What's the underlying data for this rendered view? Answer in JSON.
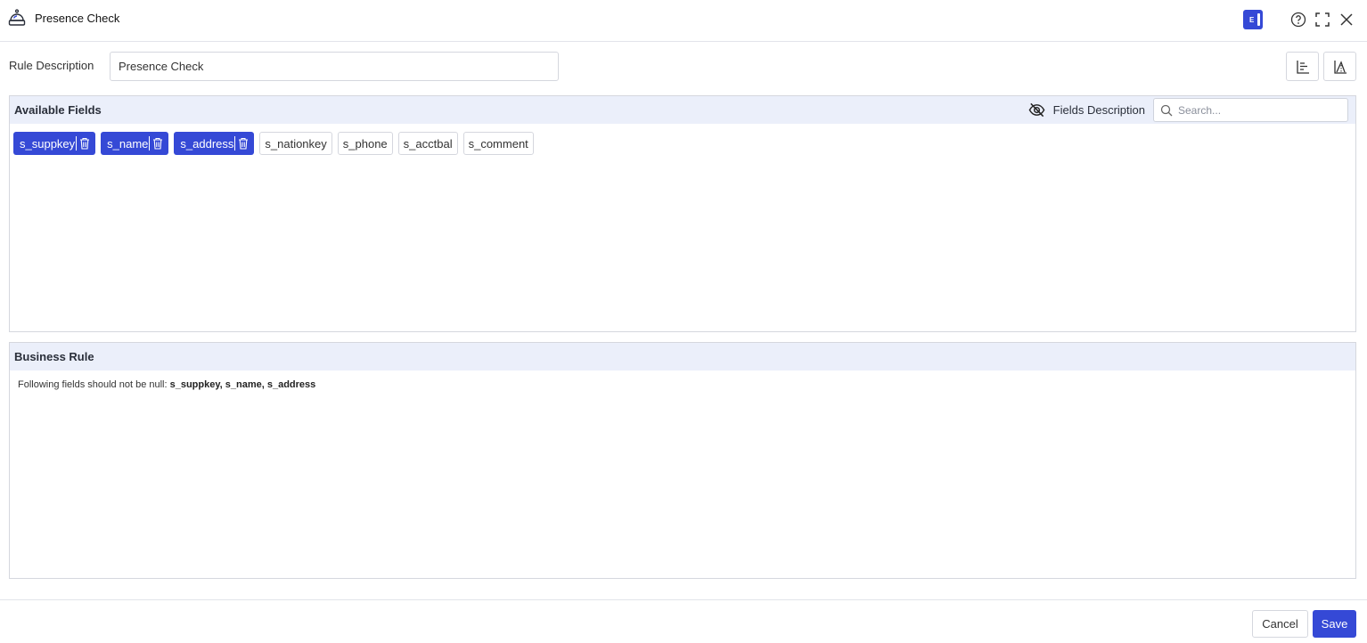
{
  "header": {
    "title": "Presence Check",
    "badge_letter": "E",
    "icons": [
      "help-circle-icon",
      "fullscreen-icon",
      "close-icon"
    ]
  },
  "rule": {
    "label": "Rule Description",
    "value": "Presence Check"
  },
  "available_fields": {
    "title": "Available Fields",
    "description_label": "Fields Description",
    "search_placeholder": "Search...",
    "selected": [
      "s_suppkey",
      "s_name",
      "s_address"
    ],
    "unselected": [
      "s_nationkey",
      "s_phone",
      "s_acctbal",
      "s_comment"
    ]
  },
  "business_rule": {
    "title": "Business Rule",
    "prefix": "Following fields should not be null:",
    "fields_text": "s_suppkey, s_name, s_address"
  },
  "footer": {
    "cancel_label": "Cancel",
    "save_label": "Save"
  },
  "colors": {
    "accent": "#3549d6",
    "panel_header": "#ebeffa",
    "border": "#d5d7de"
  }
}
